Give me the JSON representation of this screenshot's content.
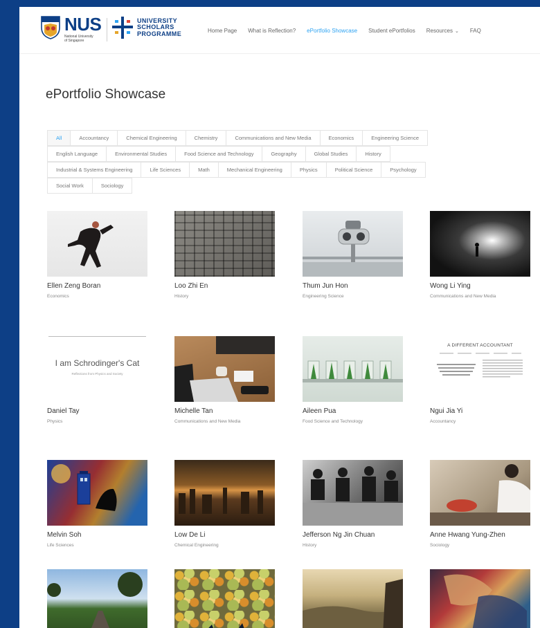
{
  "header": {
    "nus_logo_text": "NUS",
    "nus_logo_sub": "National University\nof Singapore",
    "usp_logo_lines": [
      "UNIVERSITY",
      "SCHOLARS",
      "PROGRAMME"
    ],
    "nav": [
      {
        "label": "Home Page",
        "active": false
      },
      {
        "label": "What is Reflection?",
        "active": false
      },
      {
        "label": "ePortfolio Showcase",
        "active": true
      },
      {
        "label": "Student ePortfolios",
        "active": false
      },
      {
        "label": "Resources",
        "active": false,
        "caret": "⌄"
      },
      {
        "label": "FAQ",
        "active": false
      }
    ]
  },
  "page_title": "ePortfolio Showcase",
  "filters": [
    [
      "All",
      "Accountancy",
      "Chemical Engineering",
      "Chemistry",
      "Communications and New Media",
      "Economics",
      "Engineering Science"
    ],
    [
      "English Language",
      "Environmental Studies",
      "Food Science and Technology",
      "Geography",
      "Global Studies",
      "History"
    ],
    [
      "Industrial & Systems Engineering",
      "Life Sciences",
      "Math",
      "Mechanical Engineering",
      "Physics",
      "Political Science",
      "Psychology"
    ],
    [
      "Social Work",
      "Sociology"
    ]
  ],
  "active_filter": "All",
  "cards": [
    {
      "name": "Ellen Zeng Boran",
      "category": "Economics",
      "thumb": "dance"
    },
    {
      "name": "Loo Zhi En",
      "category": "History",
      "thumb": "cobble"
    },
    {
      "name": "Thum Jun Hon",
      "category": "Engineering Science",
      "thumb": "binoc"
    },
    {
      "name": "Wong Li Ying",
      "category": "Communications and New Media",
      "thumb": "tunnel"
    },
    {
      "name": "Daniel Tay",
      "category": "Physics",
      "thumb": "cat",
      "thumb_title": "I am Schrodinger's Cat",
      "thumb_sub": "Reflections from Physics and Society"
    },
    {
      "name": "Michelle Tan",
      "category": "Communications and New Media",
      "thumb": "laptop"
    },
    {
      "name": "Aileen Pua",
      "category": "Food Science and Technology",
      "thumb": "plants"
    },
    {
      "name": "Ngui Jia Yi",
      "category": "Accountancy",
      "thumb": "doc",
      "thumb_title": "A DIFFERENT ACCOUNTANT"
    },
    {
      "name": "Melvin Soh",
      "category": "Life Sciences",
      "thumb": "painting"
    },
    {
      "name": "Low De Li",
      "category": "Chemical Engineering",
      "thumb": "sunset"
    },
    {
      "name": "Jefferson Ng Jin Chuan",
      "category": "History",
      "thumb": "bw"
    },
    {
      "name": "Anne Hwang Yung-Zhen",
      "category": "Sociology",
      "thumb": "craft"
    },
    {
      "name": "",
      "category": "",
      "thumb": "field"
    },
    {
      "name": "",
      "category": "",
      "thumb": "leaves"
    },
    {
      "name": "",
      "category": "",
      "thumb": "hills"
    },
    {
      "name": "",
      "category": "",
      "thumb": "mural"
    }
  ],
  "colors": {
    "brand_blue": "#0d3f86",
    "accent": "#2ea3f2",
    "text": "#333333",
    "muted": "#888888"
  }
}
